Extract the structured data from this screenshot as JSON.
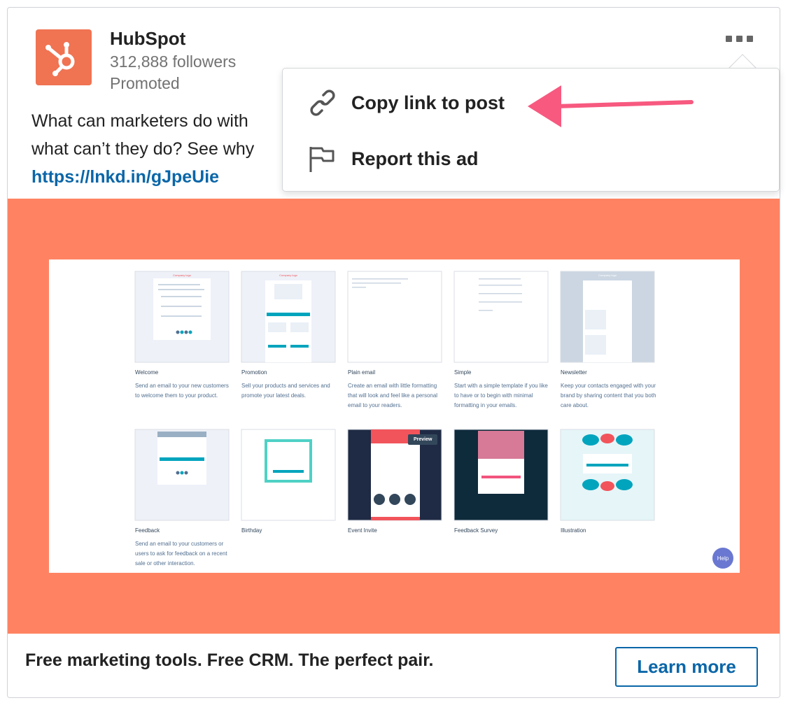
{
  "post": {
    "company": "HubSpot",
    "followers": "312,888 followers",
    "promoted": "Promoted",
    "text_line1": "What can marketers do with",
    "text_line2": "what can’t they do? See why",
    "link": "https://lnkd.in/gJpeUie"
  },
  "menu": {
    "items": [
      {
        "label": "Copy link to post",
        "icon": "link-icon"
      },
      {
        "label": "Report this ad",
        "icon": "flag-icon"
      }
    ]
  },
  "templates": {
    "row1": [
      {
        "title": "Welcome",
        "desc": "Send an email to your new customers to welcome them to your product."
      },
      {
        "title": "Promotion",
        "desc": "Sell your products and services and promote your latest deals."
      },
      {
        "title": "Plain email",
        "desc": "Create an email with little formatting that will look and feel like a personal email to your readers."
      },
      {
        "title": "Simple",
        "desc": "Start with a simple template if you like to have or to begin with minimal formatting in your emails."
      },
      {
        "title": "Newsletter",
        "desc": "Keep your contacts engaged with your brand by sharing content that you both care about."
      }
    ],
    "row2": [
      {
        "title": "Feedback",
        "desc": "Send an email to your customers or users to ask for feedback on a recent sale or other interaction."
      },
      {
        "title": "Birthday",
        "desc": ""
      },
      {
        "title": "Event Invite",
        "desc": ""
      },
      {
        "title": "Feedback Survey",
        "desc": ""
      },
      {
        "title": "Illustration",
        "desc": ""
      }
    ],
    "preview_label": "Preview",
    "help_label": "Help"
  },
  "footer": {
    "headline": "Free marketing tools. Free CRM. The perfect pair.",
    "cta": "Learn more"
  },
  "colors": {
    "brand": "#f07352",
    "image_bg": "#ff8363",
    "link": "#0a66a8",
    "arrow": "#f7597f"
  }
}
